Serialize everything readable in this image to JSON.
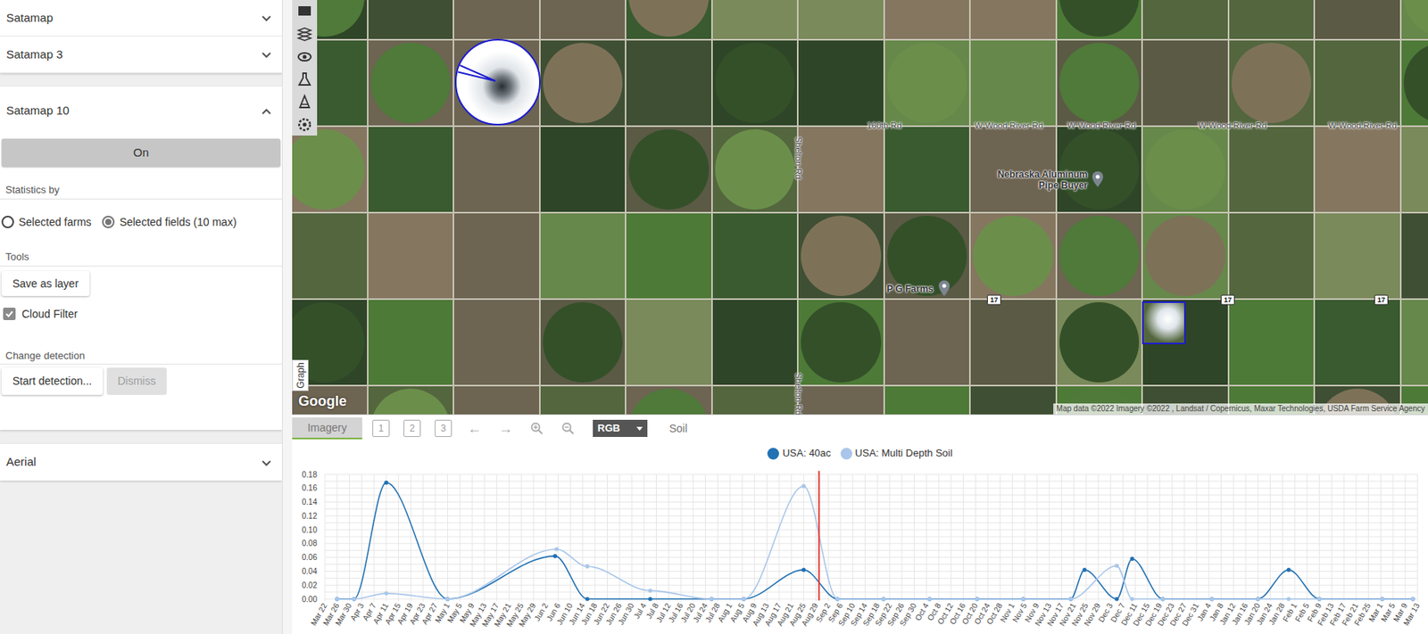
{
  "sidebar": {
    "sections": [
      {
        "title": "Satamap",
        "expanded": false
      },
      {
        "title": "Satamap 3",
        "expanded": false
      }
    ],
    "panel": {
      "title": "Satamap 10",
      "expanded": true,
      "toggle_button": "On",
      "statistics_label": "Statistics by",
      "statistics_options": [
        {
          "label": "Selected farms",
          "selected": false
        },
        {
          "label": "Selected fields (10 max)",
          "selected": true
        }
      ],
      "tools_label": "Tools",
      "save_button": "Save as layer",
      "cloud_filter": {
        "label": "Cloud Filter",
        "checked": true
      },
      "change_detection_label": "Change detection",
      "change_buttons": [
        {
          "label": "Start detection...",
          "disabled": false
        },
        {
          "label": "Dismiss",
          "disabled": true
        }
      ]
    },
    "footer_sections": [
      {
        "title": "Aerial",
        "expanded": false
      }
    ]
  },
  "map": {
    "road_labels": [
      "160th Rd",
      "W Wood River Rd",
      "W Wood River Rd",
      "W Wood River Rd",
      "W Wood River Rd"
    ],
    "vertical_road_labels": [
      "Shelton Rd",
      "Shelton Rd"
    ],
    "places": [
      {
        "name": "Nebraska Aluminum Pipe Buyer"
      },
      {
        "name": "P G Farms"
      }
    ],
    "route_shields": [
      "17",
      "17",
      "17"
    ],
    "logo": "Google",
    "attribution": "Map data ©2022 Imagery ©2022 , Landsat / Copernicus, Maxar Technologies, USDA Farm Service Agency",
    "graph_tab": "Graph"
  },
  "chart_toolbar": {
    "tabs": [
      {
        "label": "Imagery",
        "selected": true
      }
    ],
    "numbered_buttons": [
      "1",
      "2",
      "3"
    ],
    "arrows": [
      "←",
      "→"
    ],
    "band_select": "RGB",
    "soil_label": "Soil"
  },
  "chart": {
    "series": [
      {
        "name": "USA: 40ac",
        "color": "#2271b3",
        "points": [
          [
            4,
            0
          ],
          [
            9.5,
            0
          ],
          [
            20,
            0.168
          ],
          [
            40,
            0
          ],
          [
            75,
            0.062
          ],
          [
            85.5,
            0
          ],
          [
            106,
            0
          ],
          [
            126,
            0
          ],
          [
            136.5,
            0
          ],
          [
            156,
            0.042
          ],
          [
            167,
            0
          ],
          [
            182,
            0
          ],
          [
            197,
            0
          ],
          [
            212.5,
            0
          ],
          [
            227.5,
            0
          ],
          [
            243,
            0
          ],
          [
            247.5,
            0.042
          ],
          [
            258,
            0
          ],
          [
            263,
            0.058
          ],
          [
            273,
            0
          ],
          [
            289,
            0
          ],
          [
            304,
            0
          ],
          [
            314,
            0.042
          ],
          [
            324,
            0
          ],
          [
            344.5,
            0
          ],
          [
            354.5,
            0
          ]
        ]
      },
      {
        "name": "USA: Multi Depth Soil",
        "color": "#a9c6ea",
        "points": [
          [
            4,
            0
          ],
          [
            9.5,
            0
          ],
          [
            20,
            0.008
          ],
          [
            40,
            0
          ],
          [
            75.5,
            0.072
          ],
          [
            85.5,
            0.047
          ],
          [
            106,
            0.012
          ],
          [
            126,
            0
          ],
          [
            136.5,
            0
          ],
          [
            156,
            0.163
          ],
          [
            167,
            0
          ],
          [
            182,
            0
          ],
          [
            197,
            0
          ],
          [
            212.5,
            0
          ],
          [
            227.5,
            0
          ],
          [
            243,
            0
          ],
          [
            258,
            0.048
          ],
          [
            263,
            0
          ],
          [
            273,
            0
          ],
          [
            289,
            0
          ],
          [
            304,
            0
          ],
          [
            314,
            0
          ],
          [
            324,
            0
          ],
          [
            344.5,
            0
          ],
          [
            354.5,
            0
          ]
        ]
      }
    ],
    "y_ticks": [
      "0.18",
      "0.16",
      "0.14",
      "0.12",
      "0.10",
      "0.08",
      "0.06",
      "0.04",
      "0.02",
      "0.00"
    ],
    "x_ticks": [
      "Mar 22",
      "Mar 26",
      "Mar 30",
      "Apr 3",
      "Apr 7",
      "Apr 11",
      "Apr 15",
      "Apr 19",
      "Apr 23",
      "Apr 27",
      "May 1",
      "May 5",
      "May 9",
      "May 13",
      "May 17",
      "May 21",
      "May 25",
      "May 29",
      "Jun 2",
      "Jun 6",
      "Jun 10",
      "Jun 14",
      "Jun 18",
      "Jun 22",
      "Jun 26",
      "Jun 30",
      "Jul 4",
      "Jul 8",
      "Jul 12",
      "Jul 16",
      "Jul 20",
      "Jul 24",
      "Jul 28",
      "Aug 1",
      "Aug 5",
      "Aug 9",
      "Aug 13",
      "Aug 17",
      "Aug 21",
      "Aug 25",
      "Aug 29",
      "Sep 2",
      "Sep 6",
      "Sep 10",
      "Sep 14",
      "Sep 18",
      "Sep 22",
      "Sep 26",
      "Sep 30",
      "Oct 4",
      "Oct 8",
      "Oct 12",
      "Oct 16",
      "Oct 20",
      "Oct 24",
      "Oct 28",
      "Nov 1",
      "Nov 5",
      "Nov 9",
      "Nov 13",
      "Nov 17",
      "Nov 21",
      "Nov 25",
      "Nov 29",
      "Dec 3",
      "Dec 7",
      "Dec 11",
      "Dec 15",
      "Dec 19",
      "Dec 23",
      "Dec 27",
      "Dec 31",
      "Jan 4",
      "Jan 8",
      "Jan 12",
      "Jan 16",
      "Jan 20",
      "Jan 24",
      "Jan 28",
      "Feb 1",
      "Feb 5",
      "Feb 9",
      "Feb 13",
      "Feb 17",
      "Feb 21",
      "Feb 25",
      "Mar 1",
      "Mar 5",
      "Mar 9",
      "Mar 13"
    ],
    "marker_day": 161
  }
}
